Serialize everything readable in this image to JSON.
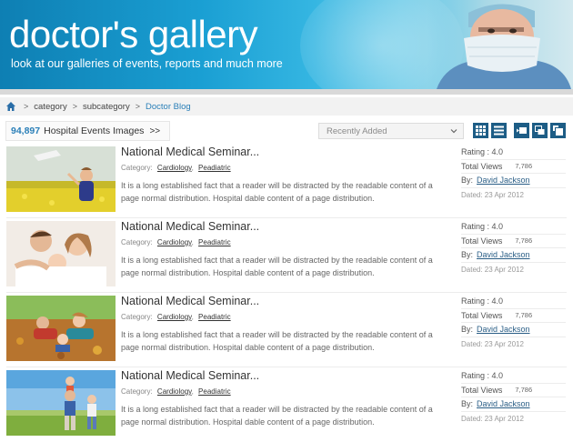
{
  "banner": {
    "title": "doctor's gallery",
    "subtitle": "look at our galleries of events, reports and much more"
  },
  "breadcrumb": {
    "items": [
      "category",
      "subcategory",
      "Doctor Blog"
    ],
    "separator": ">"
  },
  "toolbar": {
    "count": "94,897",
    "count_label": "Hospital Events Images",
    "count_arrow": ">>",
    "sort": {
      "selected": "Recently Added"
    },
    "view_buttons": [
      "grid-view-icon",
      "list-view-icon",
      "slideshow-icon",
      "gallery-icon",
      "export-icon"
    ]
  },
  "items": [
    {
      "title": "National Medical Seminar...",
      "category_label": "Category:",
      "categories": [
        "Cardiology",
        "Peadiatric"
      ],
      "description": "It is a long established fact that a reader will be distracted by the readable content of a page normal distribution. Hospital dable content of a page distribution.",
      "rating": "Rating : 4.0",
      "views_label": "Total Views",
      "views": "7,786",
      "by_label": "By:",
      "author": "David Jackson",
      "date": "Dated: 23 Apr 2012",
      "thumb": "child-in-flower-field"
    },
    {
      "title": "National Medical Seminar...",
      "category_label": "Category:",
      "categories": [
        "Cardiology",
        "Peadiatric"
      ],
      "description": "It is a long established fact that a reader will be distracted by the readable content of a page normal distribution. Hospital dable content of a page distribution.",
      "rating": "Rating : 4.0",
      "views_label": "Total Views",
      "views": "7,786",
      "by_label": "By:",
      "author": "David Jackson",
      "date": "Dated: 23 Apr 2012",
      "thumb": "family-portrait"
    },
    {
      "title": "National Medical Seminar...",
      "category_label": "Category:",
      "categories": [
        "Cardiology",
        "Peadiatric"
      ],
      "description": "It is a long established fact that a reader will be distracted by the readable content of a page normal distribution. Hospital dable content of a page distribution.",
      "rating": "Rating : 4.0",
      "views_label": "Total Views",
      "views": "7,786",
      "by_label": "By:",
      "author": "David Jackson",
      "date": "Dated: 23 Apr 2012",
      "thumb": "family-in-autumn-leaves"
    },
    {
      "title": "National Medical Seminar...",
      "category_label": "Category:",
      "categories": [
        "Cardiology",
        "Peadiatric"
      ],
      "description": "It is a long established fact that a reader will be distracted by the readable content of a page normal distribution. Hospital dable content of a page distribution.",
      "rating": "Rating : 4.0",
      "views_label": "Total Views",
      "views": "7,786",
      "by_label": "By:",
      "author": "David Jackson",
      "date": "Dated: 23 Apr 2012",
      "thumb": "family-in-meadow"
    }
  ],
  "colors": {
    "accent": "#2a7fb8",
    "button_bg": "#1d5d86"
  }
}
